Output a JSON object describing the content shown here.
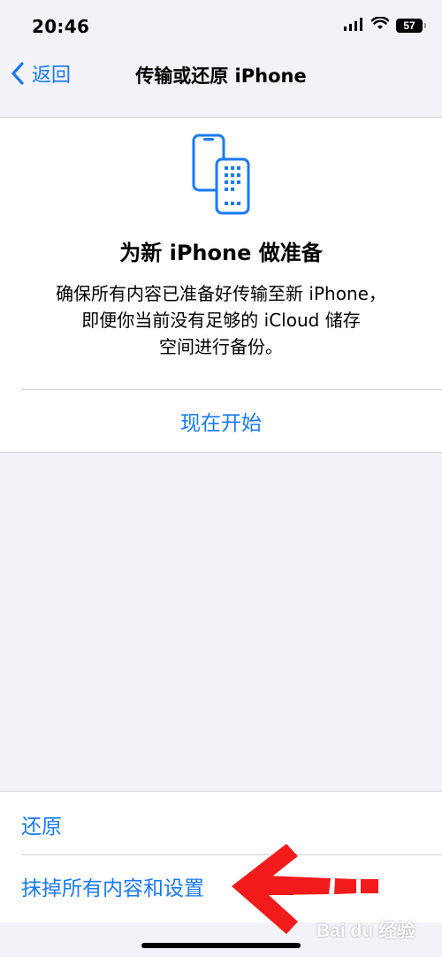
{
  "status_bar": {
    "time": "20:46",
    "battery": "57",
    "icons": [
      "signal-icon",
      "wifi-icon",
      "battery-icon"
    ]
  },
  "nav": {
    "back_label": "返回",
    "title": "传输或还原 iPhone"
  },
  "prepare_card": {
    "icon": "phone-transfer-icon",
    "title": "为新 iPhone 做准备",
    "description_lines": [
      "确保所有内容已准备好传输至新 iPhone，",
      "即便你当前没有足够的 iCloud 储存",
      "空间进行备份。"
    ],
    "action_label": "现在开始"
  },
  "bottom_list": {
    "items": [
      {
        "label": "还原"
      },
      {
        "label": "抹掉所有内容和设置"
      }
    ]
  },
  "overlay": {
    "watermark": "Bai du 经验"
  },
  "colors": {
    "accent": "#1a79f5",
    "background": "#f2f2f7",
    "annotation_arrow": "#f21b1b"
  }
}
